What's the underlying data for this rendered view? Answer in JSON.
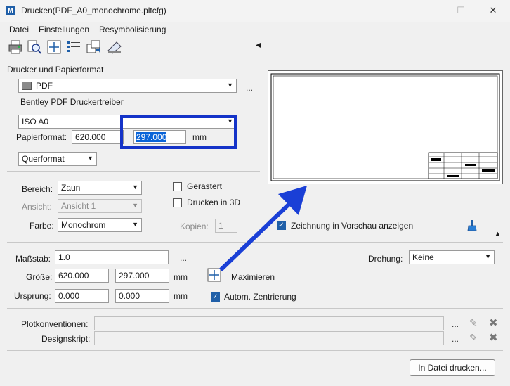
{
  "window": {
    "title": "Drucken(PDF_A0_monochrome.pltcfg)",
    "minimize": "—",
    "maximize": "☐",
    "close": "✕"
  },
  "menu": {
    "items": [
      "Datei",
      "Einstellungen",
      "Resymbolisierung"
    ]
  },
  "printer_section": {
    "heading": "Drucker und Papierformat",
    "printer": "PDF",
    "printer_more": "...",
    "driver": "Bentley PDF Druckertreiber",
    "paper_size": "ISO A0",
    "paper_label": "Papierformat:",
    "paper_width": "620.000",
    "paper_height": "297.000",
    "unit": "mm",
    "orientation": "Querformat"
  },
  "area_section": {
    "bereich_label": "Bereich:",
    "bereich_value": "Zaun",
    "ansicht_label": "Ansicht:",
    "ansicht_value": "Ansicht 1",
    "farbe_label": "Farbe:",
    "farbe_value": "Monochrom",
    "gerastert_label": "Gerastert",
    "drucken3d_label": "Drucken in 3D",
    "kopien_label": "Kopien:",
    "kopien_value": "1",
    "preview_label": "Zeichnung in Vorschau anzeigen"
  },
  "scale_section": {
    "massstab_label": "Maßstab:",
    "massstab_value": "1.0",
    "massstab_more": "...",
    "drehung_label": "Drehung:",
    "drehung_value": "Keine",
    "groesse_label": "Größe:",
    "groesse_w": "620.000",
    "groesse_h": "297.000",
    "groesse_unit": "mm",
    "maximieren_label": "Maximieren",
    "ursprung_label": "Ursprung:",
    "ursprung_x": "0.000",
    "ursprung_y": "0.000",
    "ursprung_unit": "mm",
    "zentrierung_label": "Autom. Zentrierung"
  },
  "conventions": {
    "plot_label": "Plotkonventionen:",
    "plot_value": "",
    "design_label": "Designskript:",
    "design_value": "",
    "more": "..."
  },
  "footer": {
    "print_button": "In Datei drucken..."
  },
  "colors": {
    "highlight_box": "#1433c8",
    "arrow": "#1a3fd6",
    "accent": "#1f5fa8"
  }
}
